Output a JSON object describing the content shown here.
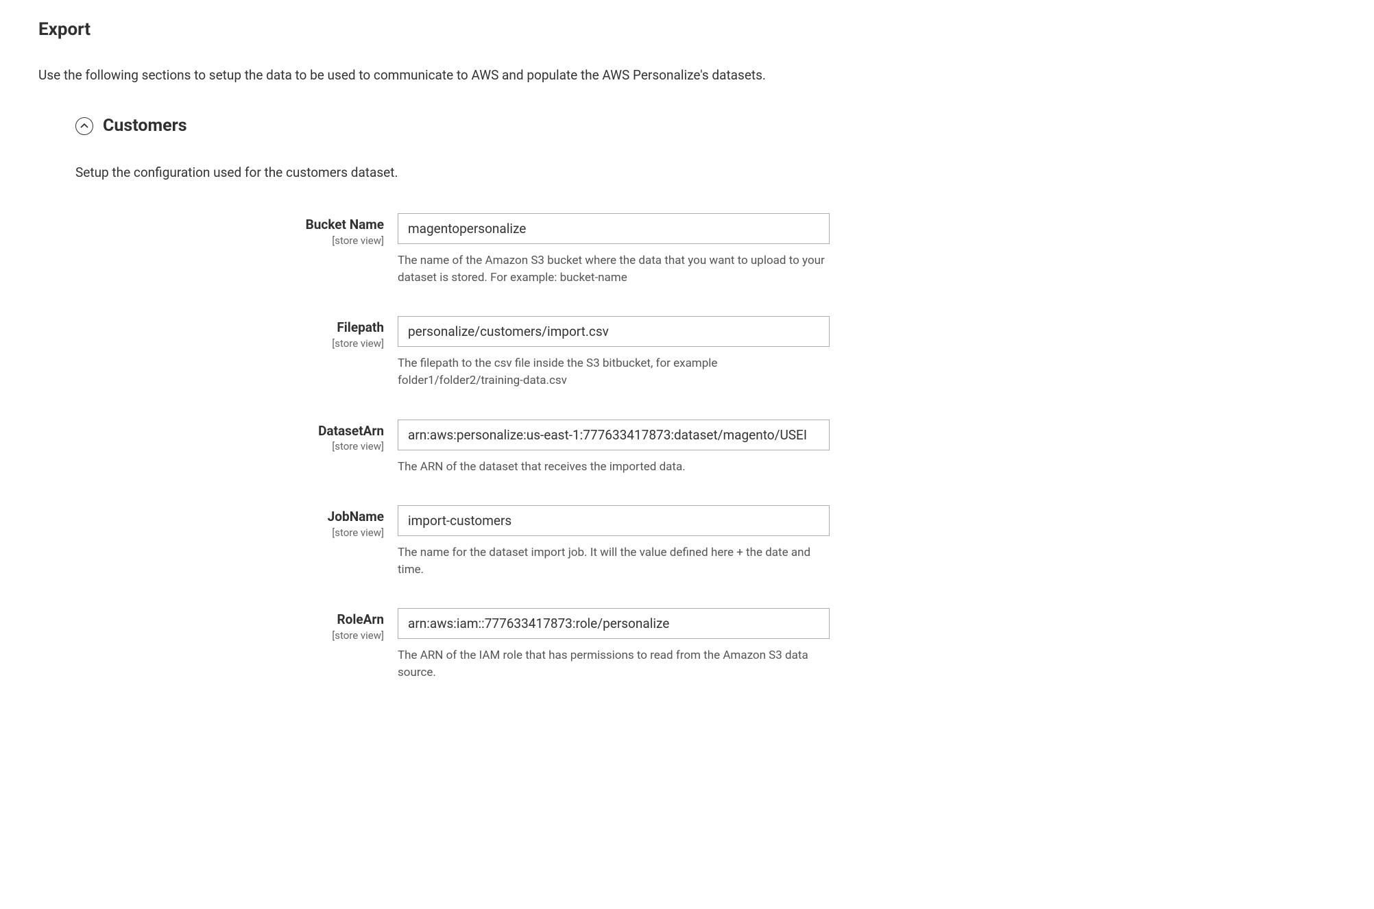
{
  "page": {
    "title": "Export",
    "description": "Use the following sections to setup the data to be used to communicate to AWS and populate the AWS Personalize's datasets."
  },
  "section": {
    "title": "Customers",
    "description": "Setup the configuration used for the customers dataset.",
    "fields": {
      "bucket_name": {
        "label": "Bucket Name",
        "scope": "[store view]",
        "value": "magentopersonalize",
        "help": "The name of the Amazon S3 bucket where the data that you want to upload to your dataset is stored. For example: bucket-name"
      },
      "filepath": {
        "label": "Filepath",
        "scope": "[store view]",
        "value": "personalize/customers/import.csv",
        "help": "The filepath to the csv file inside the S3 bitbucket, for example folder1/folder2/training-data.csv"
      },
      "dataset_arn": {
        "label": "DatasetArn",
        "scope": "[store view]",
        "value": "arn:aws:personalize:us-east-1:777633417873:dataset/magento/USEI",
        "help": "The ARN of the dataset that receives the imported data."
      },
      "job_name": {
        "label": "JobName",
        "scope": "[store view]",
        "value": "import-customers",
        "help": "The name for the dataset import job. It will the value defined here + the date and time."
      },
      "role_arn": {
        "label": "RoleArn",
        "scope": "[store view]",
        "value": "arn:aws:iam::777633417873:role/personalize",
        "help": "The ARN of the IAM role that has permissions to read from the Amazon S3 data source."
      }
    }
  }
}
